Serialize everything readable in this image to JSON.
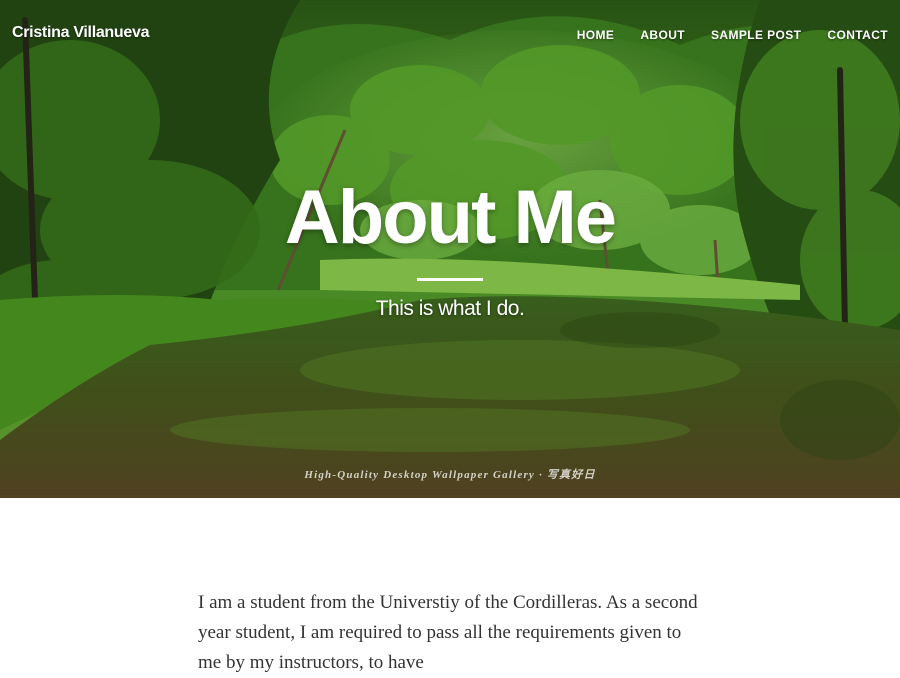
{
  "site": {
    "brand": "Cristina Villanueva",
    "nav": [
      {
        "label": "HOME"
      },
      {
        "label": "ABOUT"
      },
      {
        "label": "SAMPLE POST"
      },
      {
        "label": "CONTACT"
      }
    ]
  },
  "header": {
    "title": "About Me",
    "subheading": "This is what I do.",
    "watermark": "High-Quality Desktop Wallpaper Gallery · 写真好日"
  },
  "content": {
    "paragraph": "I am a student from the Universtiy of the Cordilleras. As a second year student, I am required to pass all the requirements given to me by my instructors, to have"
  },
  "colors": {
    "text_on_hero": "#ffffff",
    "body_text": "#333333",
    "forest_dark": "#1e3d12",
    "forest_light": "#6fbf3a",
    "water": "#3b5b22"
  }
}
